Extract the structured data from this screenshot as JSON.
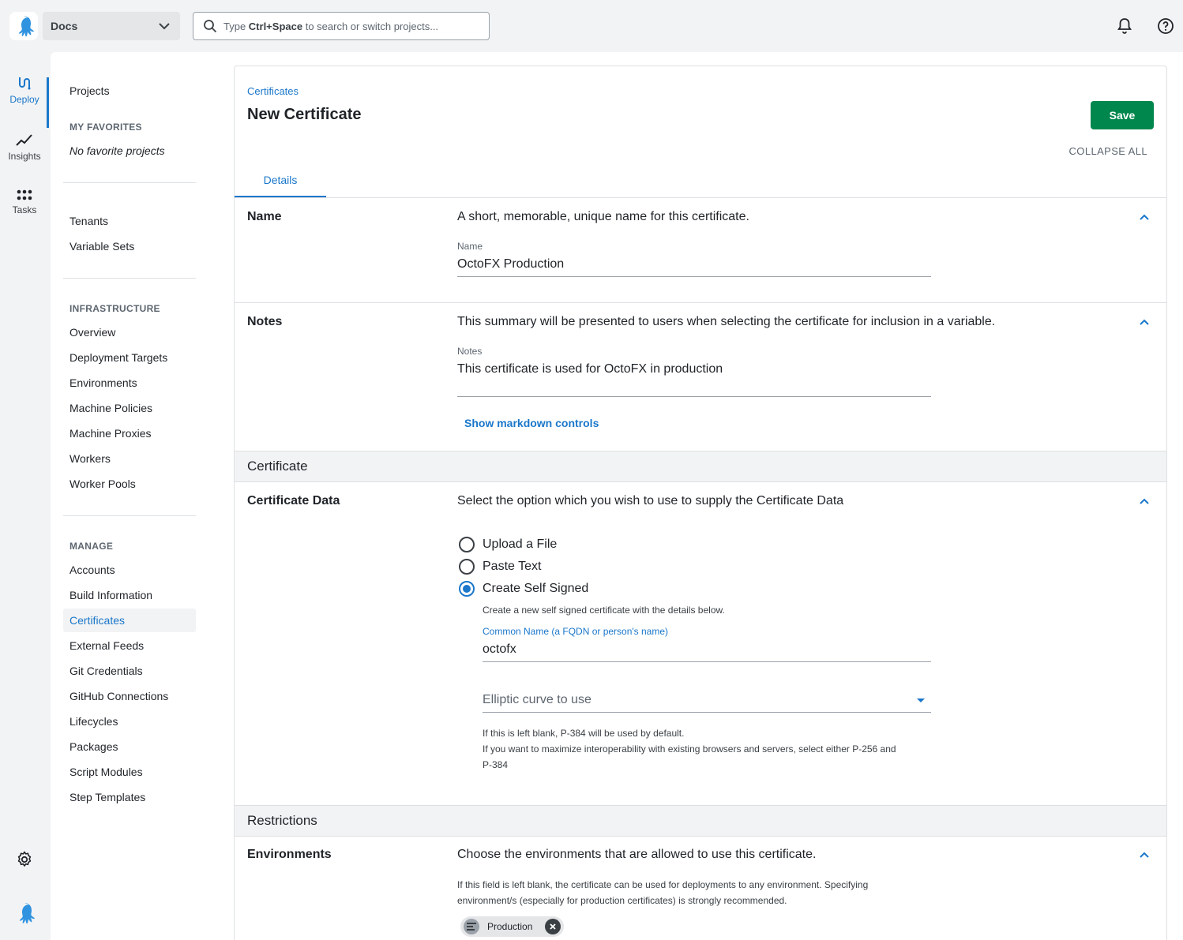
{
  "header": {
    "space_name": "Docs",
    "search_placeholder_prefix": "Type ",
    "search_placeholder_key": "Ctrl+Space",
    "search_placeholder_suffix": " to search or switch projects..."
  },
  "rail": {
    "items": [
      {
        "label": "Deploy",
        "icon": "deploy-icon"
      },
      {
        "label": "Insights",
        "icon": "insights-icon"
      },
      {
        "label": "Tasks",
        "icon": "tasks-icon"
      }
    ]
  },
  "sidebar": {
    "projects": "Projects",
    "favorites_heading": "MY FAVORITES",
    "no_favorites": "No favorite projects",
    "tenants": "Tenants",
    "variable_sets": "Variable Sets",
    "infrastructure_heading": "INFRASTRUCTURE",
    "infrastructure": [
      "Overview",
      "Deployment Targets",
      "Environments",
      "Machine Policies",
      "Machine Proxies",
      "Workers",
      "Worker Pools"
    ],
    "manage_heading": "MANAGE",
    "manage": [
      "Accounts",
      "Build Information",
      "Certificates",
      "External Feeds",
      "Git Credentials",
      "GitHub Connections",
      "Lifecycles",
      "Packages",
      "Script Modules",
      "Step Templates"
    ],
    "active": "Certificates"
  },
  "page": {
    "breadcrumb": "Certificates",
    "title": "New Certificate",
    "save_label": "Save",
    "collapse_all": "COLLAPSE ALL",
    "tab_details": "Details"
  },
  "name_section": {
    "label": "Name",
    "description": "A short, memorable, unique name for this certificate.",
    "field_label": "Name",
    "field_value": "OctoFX Production"
  },
  "notes_section": {
    "label": "Notes",
    "description": "This summary will be presented to users when selecting the certificate for inclusion in a variable.",
    "field_label": "Notes",
    "field_value": "This certificate is used for OctoFX in production",
    "markdown_link": "Show markdown controls"
  },
  "certificate_group": "Certificate",
  "certificate_data": {
    "label": "Certificate Data",
    "description": "Select the option which you wish to use to supply the Certificate Data",
    "options": [
      "Upload a File",
      "Paste Text",
      "Create Self Signed"
    ],
    "selected": "Create Self Signed",
    "self_signed_help": "Create a new self signed certificate with the details below.",
    "common_name_label": "Common Name (a FQDN or person's name)",
    "common_name_value": "octofx",
    "curve_placeholder": "Elliptic curve to use",
    "curve_help_1": "If this is left blank, P-384 will be used by default.",
    "curve_help_2": "If you want to maximize interoperability with existing browsers and servers, select either P-256 and",
    "curve_help_3": "P-384"
  },
  "restrictions_group": "Restrictions",
  "environments": {
    "label": "Environments",
    "description": "Choose the environments that are allowed to use this certificate.",
    "help_1": "If this field is left blank, the certificate can be used for deployments to any environment. Specifying",
    "help_2": "environment/s (especially for production certificates) is strongly recommended.",
    "chips": [
      "Production"
    ]
  },
  "colors": {
    "accent": "#1a77ca",
    "save": "#00874d"
  }
}
